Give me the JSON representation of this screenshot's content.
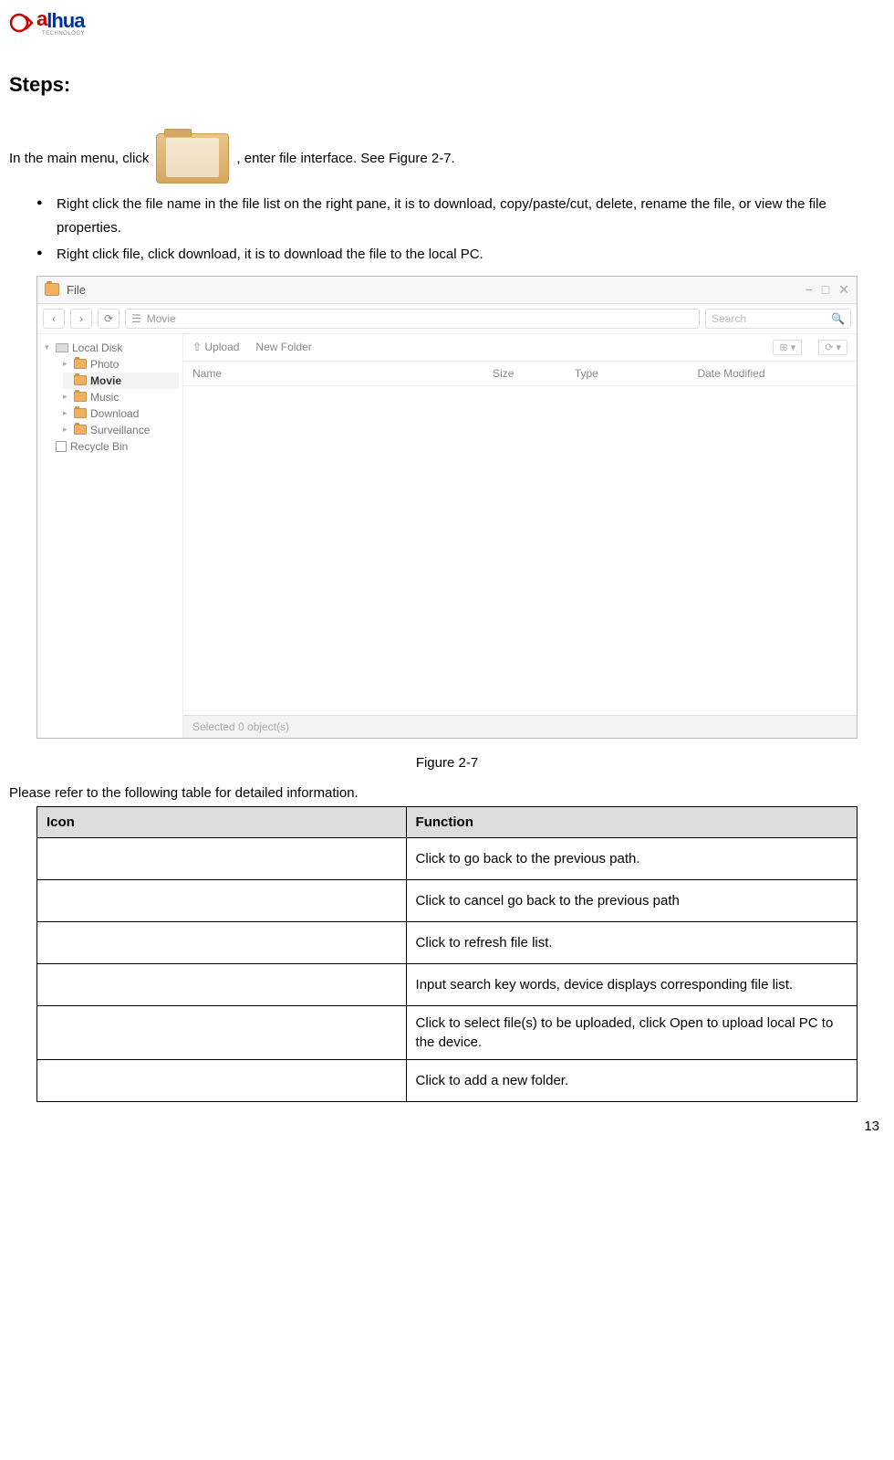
{
  "logo": {
    "brand_a": "a",
    "brand_rest": "lhua",
    "sub": "TECHNOLOGY"
  },
  "heading": "Steps:",
  "intro": {
    "pre": "In the main menu, click ",
    "post": ", enter file interface. See Figure 2-7."
  },
  "bullets": [
    "Right click the file name in the file list on the right pane, it is to download, copy/paste/cut, delete, rename the file, or view the file properties.",
    "Right click file, click download, it is to download the file to the local PC."
  ],
  "app": {
    "title": "File",
    "path_hint": "☰",
    "path_value": "Movie",
    "search_placeholder": "Search",
    "actions": {
      "upload": "⇧ Upload",
      "new_folder": "New Folder"
    },
    "columns": {
      "name": "Name",
      "size": "Size",
      "type": "Type",
      "date": "Date Modified"
    },
    "tree": {
      "root": "Local Disk",
      "items": [
        "Photo",
        "Movie",
        "Music",
        "Download",
        "Surveillance"
      ],
      "recycle": "Recycle Bin"
    },
    "status": "Selected 0 object(s)",
    "win": {
      "min": "−",
      "max": "□",
      "close": "✕"
    },
    "view_grid": "⊞ ▾",
    "view_more": "⟳ ▾"
  },
  "figure_caption": "Figure 2-7",
  "table_intro": "Please refer to the following table for detailed information.",
  "table": {
    "header_icon": "Icon",
    "header_func": "Function",
    "rows": [
      "Click to go back to the previous path.",
      "Click to cancel go back to the previous path",
      "Click to refresh file list.",
      "Input search key words, device displays corresponding file list.",
      "Click to select file(s) to be uploaded, click Open to upload local PC to the device.",
      "Click to add a new folder."
    ]
  },
  "page_number": "13"
}
